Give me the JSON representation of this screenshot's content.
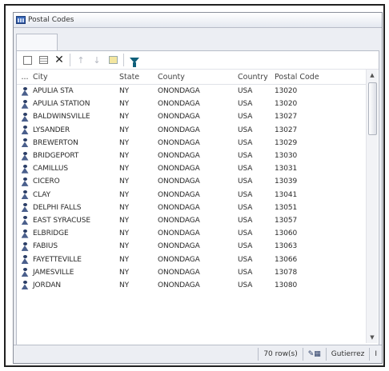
{
  "window": {
    "title": "Postal Codes"
  },
  "toolbar": {
    "new_icon": "new-record-icon",
    "grid_icon": "grid-view-icon",
    "delete_symbol": "✕",
    "up_symbol": "↑",
    "down_symbol": "↓",
    "filter_icon": "filter-icon"
  },
  "grid": {
    "headers": {
      "indicator": "...",
      "city": "City",
      "state": "State",
      "county": "County",
      "country": "Country",
      "postal_code": "Postal Code"
    },
    "rows": [
      {
        "city": "APULIA STA",
        "state": "NY",
        "county": "ONONDAGA",
        "country": "USA",
        "postal_code": "13020"
      },
      {
        "city": "APULIA STATION",
        "state": "NY",
        "county": "ONONDAGA",
        "country": "USA",
        "postal_code": "13020"
      },
      {
        "city": "BALDWINSVILLE",
        "state": "NY",
        "county": "ONONDAGA",
        "country": "USA",
        "postal_code": "13027"
      },
      {
        "city": "LYSANDER",
        "state": "NY",
        "county": "ONONDAGA",
        "country": "USA",
        "postal_code": "13027"
      },
      {
        "city": "BREWERTON",
        "state": "NY",
        "county": "ONONDAGA",
        "country": "USA",
        "postal_code": "13029"
      },
      {
        "city": "BRIDGEPORT",
        "state": "NY",
        "county": "ONONDAGA",
        "country": "USA",
        "postal_code": "13030"
      },
      {
        "city": "CAMILLUS",
        "state": "NY",
        "county": "ONONDAGA",
        "country": "USA",
        "postal_code": "13031"
      },
      {
        "city": "CICERO",
        "state": "NY",
        "county": "ONONDAGA",
        "country": "USA",
        "postal_code": "13039"
      },
      {
        "city": "CLAY",
        "state": "NY",
        "county": "ONONDAGA",
        "country": "USA",
        "postal_code": "13041"
      },
      {
        "city": "DELPHI FALLS",
        "state": "NY",
        "county": "ONONDAGA",
        "country": "USA",
        "postal_code": "13051"
      },
      {
        "city": "EAST SYRACUSE",
        "state": "NY",
        "county": "ONONDAGA",
        "country": "USA",
        "postal_code": "13057"
      },
      {
        "city": "ELBRIDGE",
        "state": "NY",
        "county": "ONONDAGA",
        "country": "USA",
        "postal_code": "13060"
      },
      {
        "city": "FABIUS",
        "state": "NY",
        "county": "ONONDAGA",
        "country": "USA",
        "postal_code": "13063"
      },
      {
        "city": "FAYETTEVILLE",
        "state": "NY",
        "county": "ONONDAGA",
        "country": "USA",
        "postal_code": "13066"
      },
      {
        "city": "JAMESVILLE",
        "state": "NY",
        "county": "ONONDAGA",
        "country": "USA",
        "postal_code": "13078"
      },
      {
        "city": "JORDAN",
        "state": "NY",
        "county": "ONONDAGA",
        "country": "USA",
        "postal_code": "13080"
      }
    ]
  },
  "status": {
    "row_count": "70 row(s)",
    "user": "Gutierrez",
    "trailing": "I"
  }
}
